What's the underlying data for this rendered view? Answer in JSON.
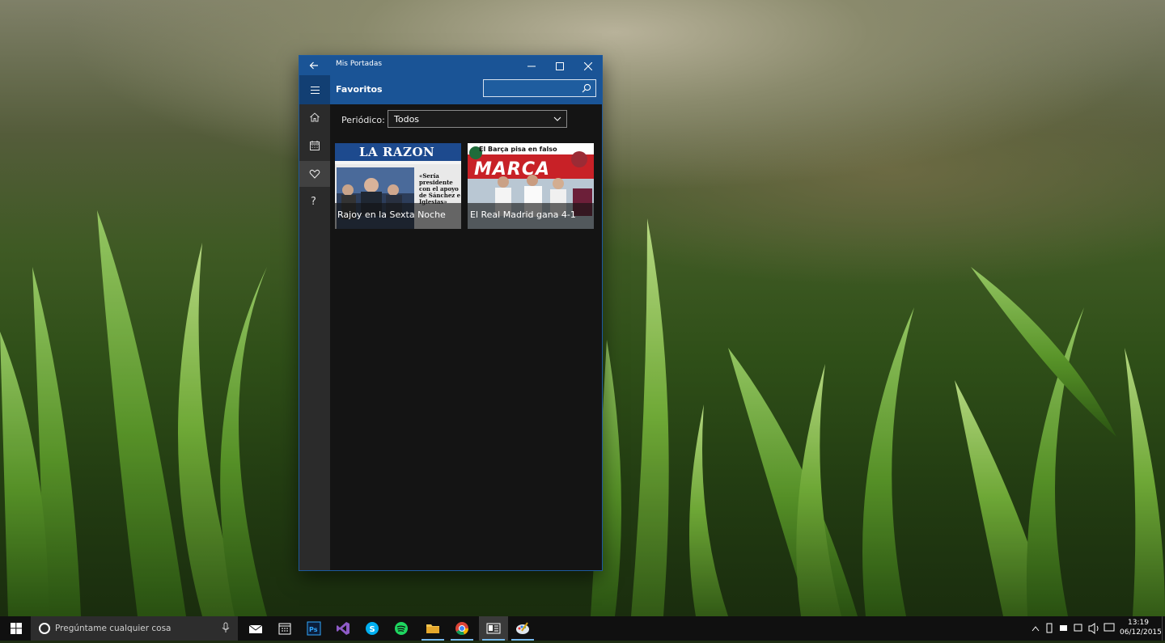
{
  "window": {
    "title": "Mis Portadas",
    "page_title": "Favoritos",
    "search": {
      "placeholder": ""
    }
  },
  "sidebar": {
    "items": [
      {
        "name": "home",
        "icon": "home-icon",
        "active": false
      },
      {
        "name": "calendar",
        "icon": "calendar-icon",
        "active": false
      },
      {
        "name": "favorites",
        "icon": "heart-icon",
        "active": true
      },
      {
        "name": "help",
        "icon": "help-icon",
        "active": false,
        "glyph": "?"
      }
    ]
  },
  "filter": {
    "label": "Periódico:",
    "selected": "Todos"
  },
  "covers": [
    {
      "newspaper_logo": "LA RAZON",
      "headline": "«Sería presidente con el apoyo de Sánchez e Iglesias»",
      "caption": "Rajoy en la Sexta Noche"
    },
    {
      "newspaper_logo": "MARCA",
      "headline": "El Barça pisa en falso",
      "caption": "El Real Madrid gana 4-1"
    }
  ],
  "taskbar": {
    "search_placeholder": "Pregúntame cualquier cosa",
    "apps": [
      "mail",
      "calendar",
      "photoshop",
      "visual-studio",
      "skype",
      "spotify",
      "file-explorer",
      "chrome",
      "mis-portadas",
      "paint"
    ],
    "clock": {
      "time": "13:19",
      "date": "06/12/2015"
    }
  },
  "colors": {
    "accent": "#1a5496",
    "window_bg": "#141414",
    "sidebar_bg": "#2b2b2b",
    "taskbar_bg": "#101010"
  }
}
